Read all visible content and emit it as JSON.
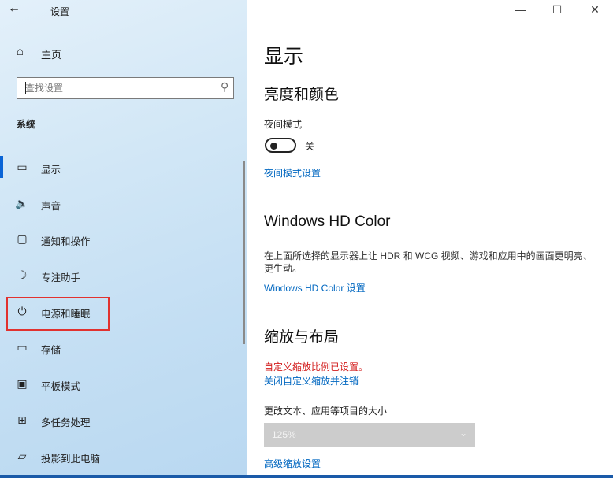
{
  "window": {
    "title": "设置",
    "back_icon": "←",
    "minimize_icon": "—",
    "maximize_icon": "☐",
    "close_icon": "✕"
  },
  "sidebar": {
    "home_icon": "⌂",
    "home_label": "主页",
    "search_placeholder": "查找设置",
    "search_icon": "⚲",
    "section_title": "系统",
    "items": [
      {
        "icon": "▭",
        "label": "显示",
        "selected": true
      },
      {
        "icon": "🔈",
        "label": "声音"
      },
      {
        "icon": "▢",
        "label": "通知和操作"
      },
      {
        "icon": "☽",
        "label": "专注助手"
      },
      {
        "icon": "⏻",
        "label": "电源和睡眠",
        "highlighted": true
      },
      {
        "icon": "▭",
        "label": "存储"
      },
      {
        "icon": "▣",
        "label": "平板模式"
      },
      {
        "icon": "⊞",
        "label": "多任务处理"
      },
      {
        "icon": "▱",
        "label": "投影到此电脑"
      }
    ],
    "colors": {
      "accent": "#0a64d6",
      "highlight_border": "#e1322f"
    }
  },
  "main": {
    "title": "显示",
    "brightness": {
      "heading": "亮度和颜色",
      "night_mode_label": "夜间模式",
      "night_mode_state": "关",
      "night_mode_settings_link": "夜间模式设置"
    },
    "hd_color": {
      "heading": "Windows HD Color",
      "description": "在上面所选择的显示器上让 HDR 和 WCG 视频、游戏和应用中的画面更明亮、更生动。",
      "settings_link": "Windows HD Color 设置"
    },
    "scale": {
      "heading": "缩放与布局",
      "warning": "自定义缩放比例已设置。",
      "signout_link": "关闭自定义缩放并注销",
      "text_size_label": "更改文本、应用等项目的大小",
      "scale_value": "125%",
      "chevron_icon": "⌄",
      "advanced_link": "高级缩放设置"
    },
    "colors": {
      "link": "#0067c0",
      "warning": "#d21c1c"
    }
  }
}
